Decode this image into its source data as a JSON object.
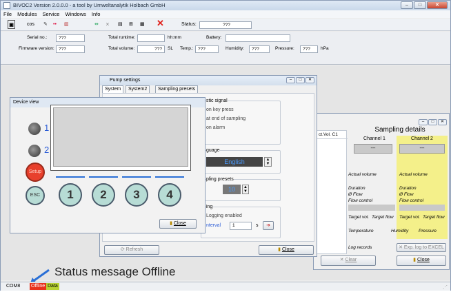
{
  "window": {
    "title": "BIVOC2 Version 2.0.0.0 - a tool by Umweltanalytik Holbach GmbH"
  },
  "menu": [
    "File",
    "Modules",
    "Service",
    "Windows",
    "Info"
  ],
  "toolbar": {
    "cos_label": "cos",
    "status_label": "Status:",
    "status_value": "???"
  },
  "info": {
    "serial_label": "Serial no.:",
    "serial_value": "???",
    "total_runtime_label": "Total runtime:",
    "runtime_unit": "hh:mm",
    "battery_label": "Battery:",
    "firmware_label": "Firmware version:",
    "firmware_value": "???",
    "total_volume_label": "Total volume:",
    "total_volume_value": "???",
    "volume_unit": "SL",
    "temp_label": "Temp.:",
    "temp_value": "???",
    "humidity_label": "Humidity:",
    "humidity_value": "???",
    "pressure_label": "Pressure:",
    "pressure_value": "???",
    "pressure_unit": "hPa"
  },
  "pump_settings": {
    "title": "Pump settings",
    "tabs": [
      "System",
      "System2",
      "Sampling presets"
    ],
    "acoustic_title": "stic signal",
    "acoustic_items": [
      "on key press",
      "at end of sampling",
      "on alarm"
    ],
    "language_title": "guage",
    "language_value": "English",
    "presets_title": "pling presets",
    "presets_value": "10",
    "logging_title": "ing",
    "logging_enabled": "Logging enabled",
    "interval_label": "nterval",
    "interval_value": "1",
    "interval_unit": "s",
    "refresh_label": "Refresh",
    "close_label": "Close"
  },
  "device_view": {
    "title": "Device view",
    "led1": "1",
    "led2": "2",
    "setup_label": "Setup",
    "esc_label": "ESC",
    "keys": [
      "1",
      "2",
      "3",
      "4"
    ],
    "close_label": "Close"
  },
  "sampling_details": {
    "title": "Sampling details",
    "col_header": "ct.Vol. C1",
    "channel1": "Channel 1",
    "channel2": "Channel 2",
    "ch_value": "---",
    "actual_volume": "Actual volume",
    "dash": "-",
    "duration": "Duration",
    "flow": "Ø Flow",
    "flow_control": "Flow control",
    "target": "Target vol.",
    "target_flow": "Target flow",
    "temperature": "Temperature",
    "humidity": "Humidity",
    "pressure": "Pressure",
    "log_records": "Log records",
    "export_label": "Exp. log to EXCEL",
    "clear_label": "Clear",
    "close_label": "Close"
  },
  "statusbar": {
    "port": "COM8",
    "offline": "Offline",
    "data": "Data"
  },
  "annotation": {
    "text": "Status message Offline"
  },
  "colors": {
    "offline": "#e8321c",
    "data": "#b8d334",
    "channel2_bg": "#f4f08a",
    "accent_blue": "#2a6fd6"
  }
}
